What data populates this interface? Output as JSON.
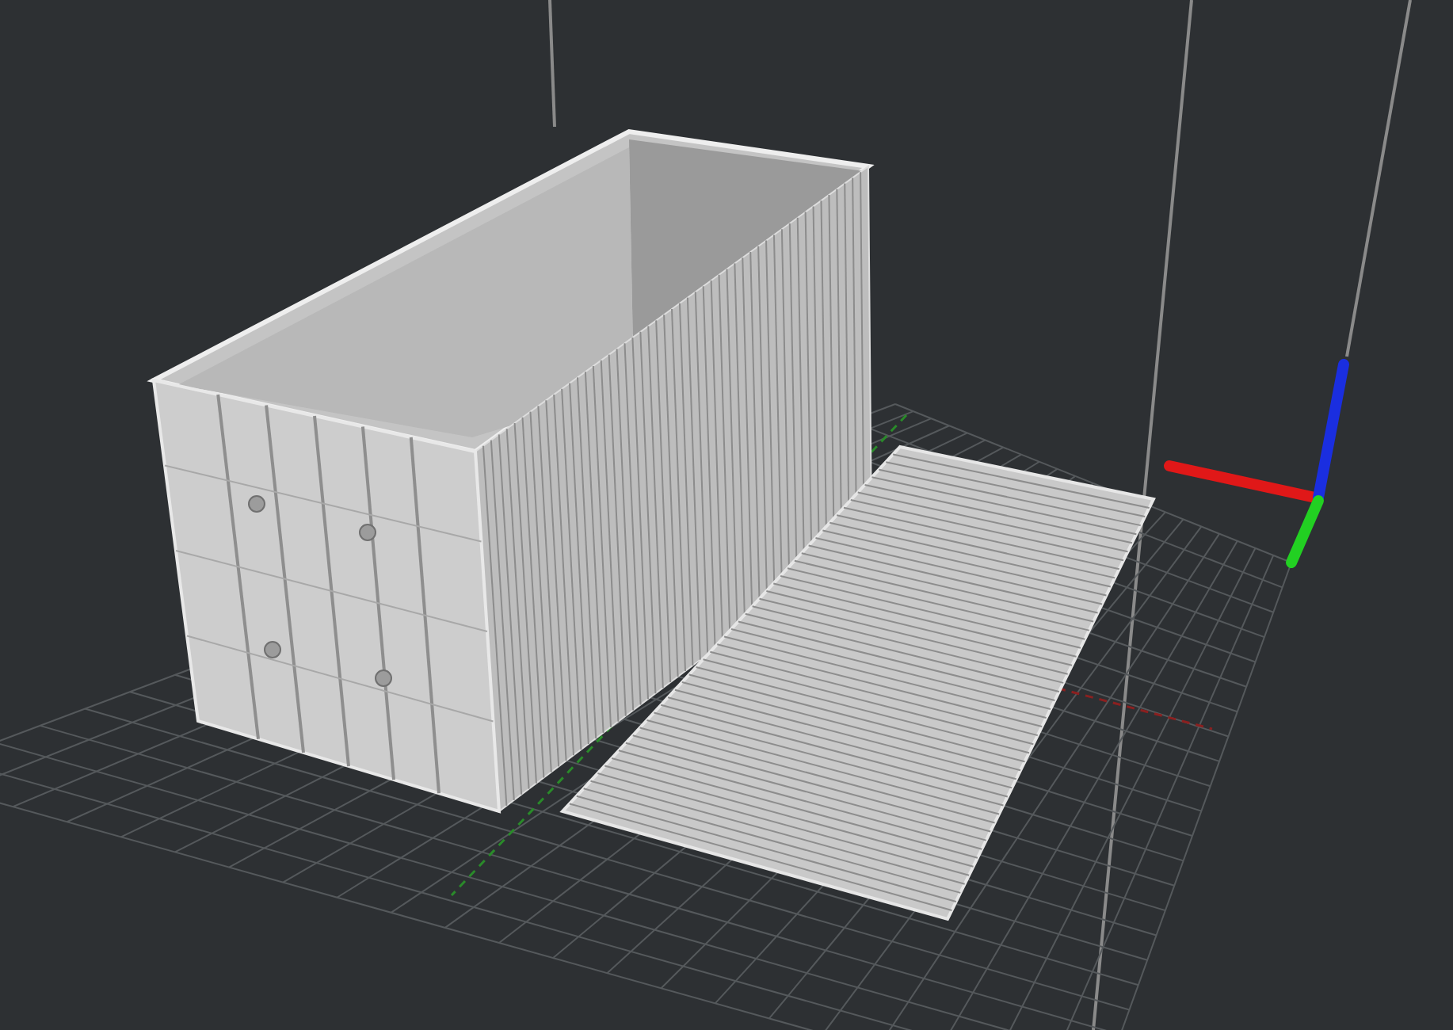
{
  "viewport": {
    "objects": [
      {
        "kind": "container"
      },
      {
        "kind": "panel"
      }
    ]
  }
}
